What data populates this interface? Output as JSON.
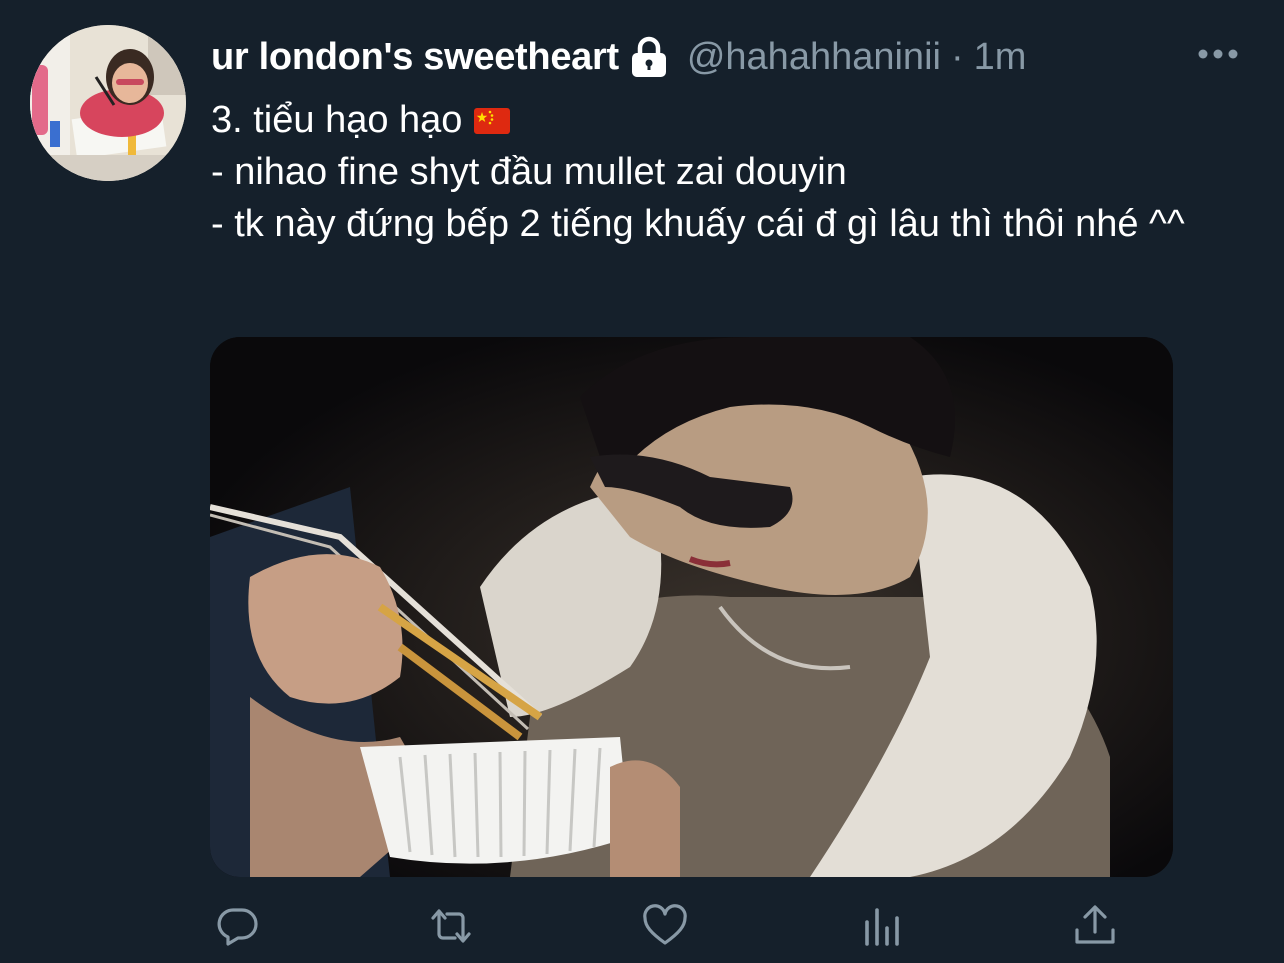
{
  "tweet": {
    "display_name": "ur london's sweetheart",
    "handle": "@hahahhaninii",
    "separator": "·",
    "timestamp": "1m",
    "lines": [
      "3. tiểu hạo hạo",
      "- nihao fine shyt đầu mullet zai douyin",
      "- tk này đứng bếp 2 tiếng khuấy cái đ gì lâu thì thôi nhé ^^"
    ]
  },
  "icons": {
    "lock": "lock-icon",
    "more": "more-icon",
    "flag": "china-flag-icon",
    "reply": "reply-icon",
    "retweet": "retweet-icon",
    "like": "heart-icon",
    "analytics": "analytics-icon",
    "share": "share-icon"
  },
  "colors": {
    "background": "#15202b",
    "text_primary": "#ffffff",
    "text_secondary": "#8899a6",
    "icon": "#8899a6"
  }
}
